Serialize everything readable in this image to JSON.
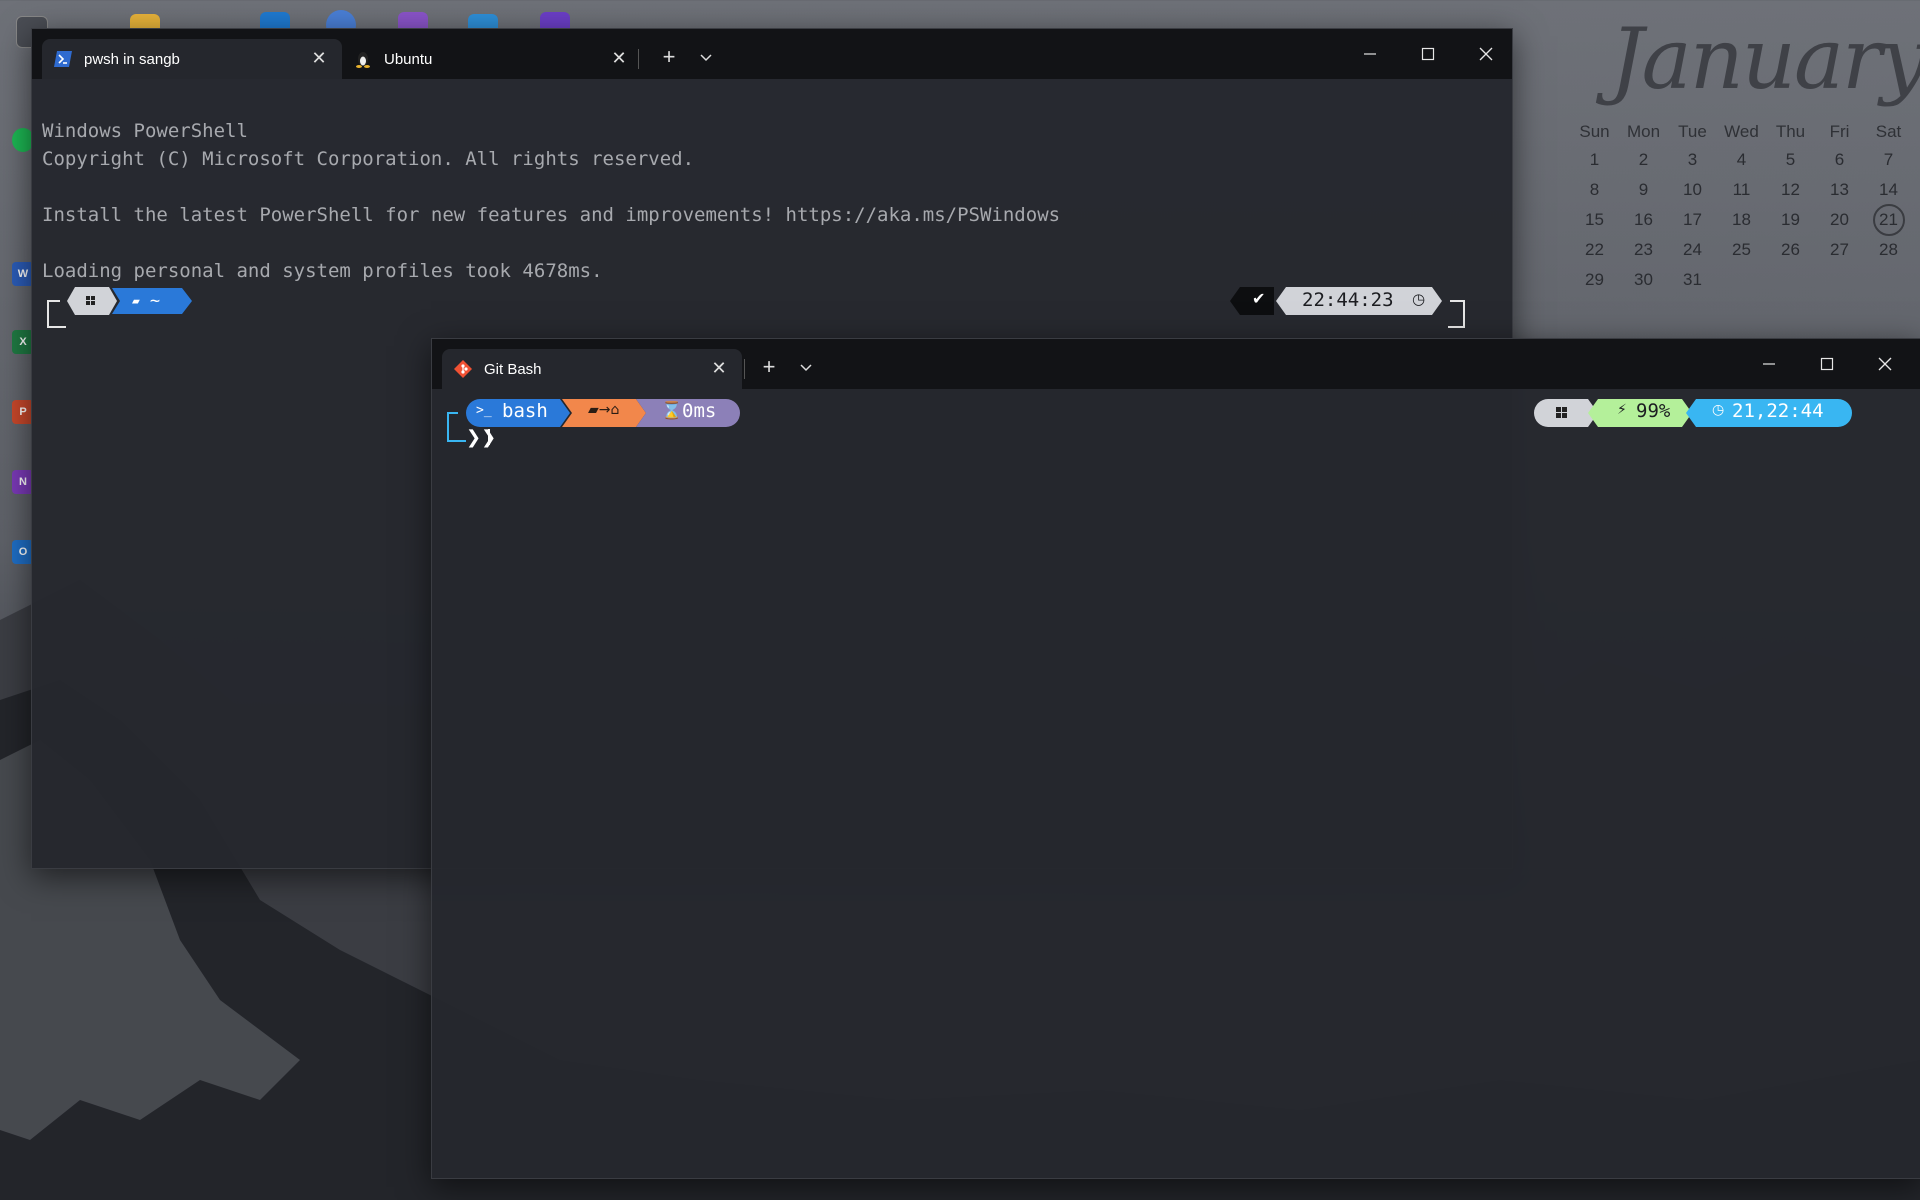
{
  "calendar": {
    "month": "January",
    "weekdays": [
      "Sun",
      "Mon",
      "Tue",
      "Wed",
      "Thu",
      "Fri",
      "Sat"
    ],
    "weeks": [
      [
        "1",
        "2",
        "3",
        "4",
        "5",
        "6",
        "7"
      ],
      [
        "8",
        "9",
        "10",
        "11",
        "12",
        "13",
        "14"
      ],
      [
        "15",
        "16",
        "17",
        "18",
        "19",
        "20",
        "21"
      ],
      [
        "22",
        "23",
        "24",
        "25",
        "26",
        "27",
        "28"
      ],
      [
        "29",
        "30",
        "31",
        "",
        "",
        "",
        ""
      ]
    ],
    "today": "21"
  },
  "window_pwsh": {
    "tabs": [
      {
        "label": "pwsh in sangb",
        "icon": "powershell-icon",
        "active": true
      },
      {
        "label": "Ubuntu",
        "icon": "linux-penguin-icon",
        "active": false
      }
    ],
    "lines": [
      "Windows PowerShell",
      "Copyright (C) Microsoft Corporation. All rights reserved.",
      "",
      "Install the latest PowerShell for new features and improvements! https://aka.ms/PSWindows",
      "",
      "Loading personal and system profiles took 4678ms."
    ],
    "prompt": {
      "path": "~",
      "status": "✔",
      "time": "22:44:23"
    }
  },
  "window_gitbash": {
    "tabs": [
      {
        "label": "Git Bash",
        "icon": "git-icon",
        "active": true
      }
    ],
    "prompt": {
      "shell": "bash",
      "duration": "0ms",
      "battery": "99%",
      "datetime": "21,22:44",
      "cursor": "❯❯"
    }
  },
  "colors": {
    "blue_seg": "#2a79d9",
    "orange_seg": "#f2874b",
    "purple_seg": "#8c80b8",
    "green_seg": "#b4f09a",
    "cyan_seg": "#39b6f2",
    "gray_seg": "#d1d3d8"
  }
}
